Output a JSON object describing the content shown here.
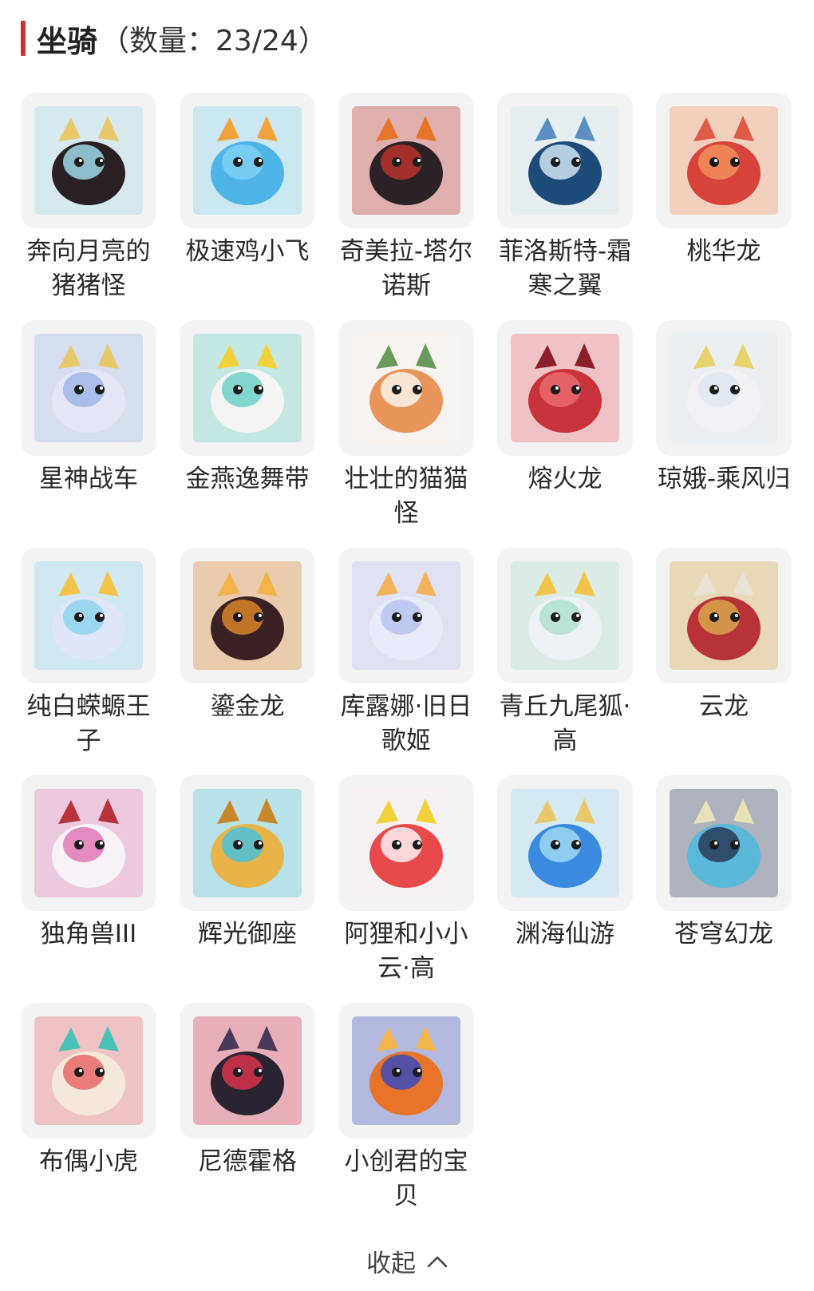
{
  "header": {
    "title": "坐骑",
    "count_text": "（数量：23/24）"
  },
  "mounts": [
    {
      "name": "奔向月亮的猪猪怪",
      "icon": "pig-mount-icon",
      "c1": "#2a2024",
      "c2": "#9fd8e8",
      "c3": "#e8c86b"
    },
    {
      "name": "极速鸡小飞",
      "icon": "blue-chick-mount-icon",
      "c1": "#4fb4e6",
      "c2": "#7fd0f2",
      "c3": "#f2a23a"
    },
    {
      "name": "奇美拉-塔尔诺斯",
      "icon": "chimera-mount-icon",
      "c1": "#2a2226",
      "c2": "#b8322c",
      "c3": "#e8742a"
    },
    {
      "name": "菲洛斯特-霜寒之翼",
      "icon": "frost-wing-mount-icon",
      "c1": "#1e4c7a",
      "c2": "#cfe4f2",
      "c3": "#5b8fc4"
    },
    {
      "name": "桃华龙",
      "icon": "peach-dragon-mount-icon",
      "c1": "#d8443c",
      "c2": "#f28f5a",
      "c3": "#e05a48"
    },
    {
      "name": "星神战车",
      "icon": "star-chariot-mount-icon",
      "c1": "#e4e6f6",
      "c2": "#9fb6e8",
      "c3": "#e8c86b"
    },
    {
      "name": "金燕逸舞带",
      "icon": "golden-swallow-ribbon-icon",
      "c1": "#f4f4f4",
      "c2": "#6fd0c8",
      "c3": "#f2d23a"
    },
    {
      "name": "壮壮的猫猫怪",
      "icon": "cat-mount-icon",
      "c1": "#e8955a",
      "c2": "#fbf3ea",
      "c3": "#6a9a5a"
    },
    {
      "name": "熔火龙",
      "icon": "magma-dragon-mount-icon",
      "c1": "#c8323a",
      "c2": "#e86a70",
      "c3": "#8a1e2a"
    },
    {
      "name": "琼娥-乘风归",
      "icon": "moon-fairy-mount-icon",
      "c1": "#f2f2f6",
      "c2": "#dfe8f2",
      "c3": "#e8d26b"
    },
    {
      "name": "纯白蝾螈王子",
      "icon": "white-axolotl-mount-icon",
      "c1": "#dfe6f8",
      "c2": "#8fd4ee",
      "c3": "#f2c44a"
    },
    {
      "name": "鎏金龙",
      "icon": "gilded-dragon-mount-icon",
      "c1": "#3a2224",
      "c2": "#d8842a",
      "c3": "#f2b44a"
    },
    {
      "name": "库露娜·旧日歌姬",
      "icon": "diva-mount-icon",
      "c1": "#e8ecf8",
      "c2": "#b6c4f0",
      "c3": "#f2b45a"
    },
    {
      "name": "青丘九尾狐·高",
      "icon": "nine-tail-fox-mount-icon",
      "c1": "#eef2f6",
      "c2": "#aee0d0",
      "c3": "#f2c44a"
    },
    {
      "name": "云龙",
      "icon": "cloud-dragon-mount-icon",
      "c1": "#b8323a",
      "c2": "#d8a64a",
      "c3": "#e8e2d6"
    },
    {
      "name": "独角兽III",
      "icon": "unicorn-mount-icon",
      "c1": "#f6f2f8",
      "c2": "#e07ab8",
      "c3": "#b8323a"
    },
    {
      "name": "辉光御座",
      "icon": "radiant-throne-mount-icon",
      "c1": "#e8b44a",
      "c2": "#4ac2d8",
      "c3": "#c8862a"
    },
    {
      "name": "阿狸和小小云·高",
      "icon": "fox-cloud-mount-icon",
      "c1": "#e8494a",
      "c2": "#fbeef2",
      "c3": "#f2d23a"
    },
    {
      "name": "渊海仙游",
      "icon": "abyss-sea-mount-icon",
      "c1": "#3a8ae0",
      "c2": "#9fd8f2",
      "c3": "#e8c86b"
    },
    {
      "name": "苍穹幻龙",
      "icon": "sky-dragon-mount-icon",
      "c1": "#5ab8d8",
      "c2": "#2a3a5a",
      "c3": "#e8e2b8"
    },
    {
      "name": "布偶小虎",
      "icon": "doll-tiger-mount-icon",
      "c1": "#f4e8d8",
      "c2": "#e86a6a",
      "c3": "#4ac2b8"
    },
    {
      "name": "尼德霍格",
      "icon": "nidhogg-mount-icon",
      "c1": "#2a2432",
      "c2": "#d8324a",
      "c3": "#4a3a5a"
    },
    {
      "name": "小创君的宝贝",
      "icon": "phoenix-bird-mount-icon",
      "c1": "#e8742a",
      "c2": "#3a4ab8",
      "c3": "#f2b44a"
    }
  ],
  "footer": {
    "collapse_label": "收起",
    "collapse_icon": "chevron-up-icon"
  }
}
